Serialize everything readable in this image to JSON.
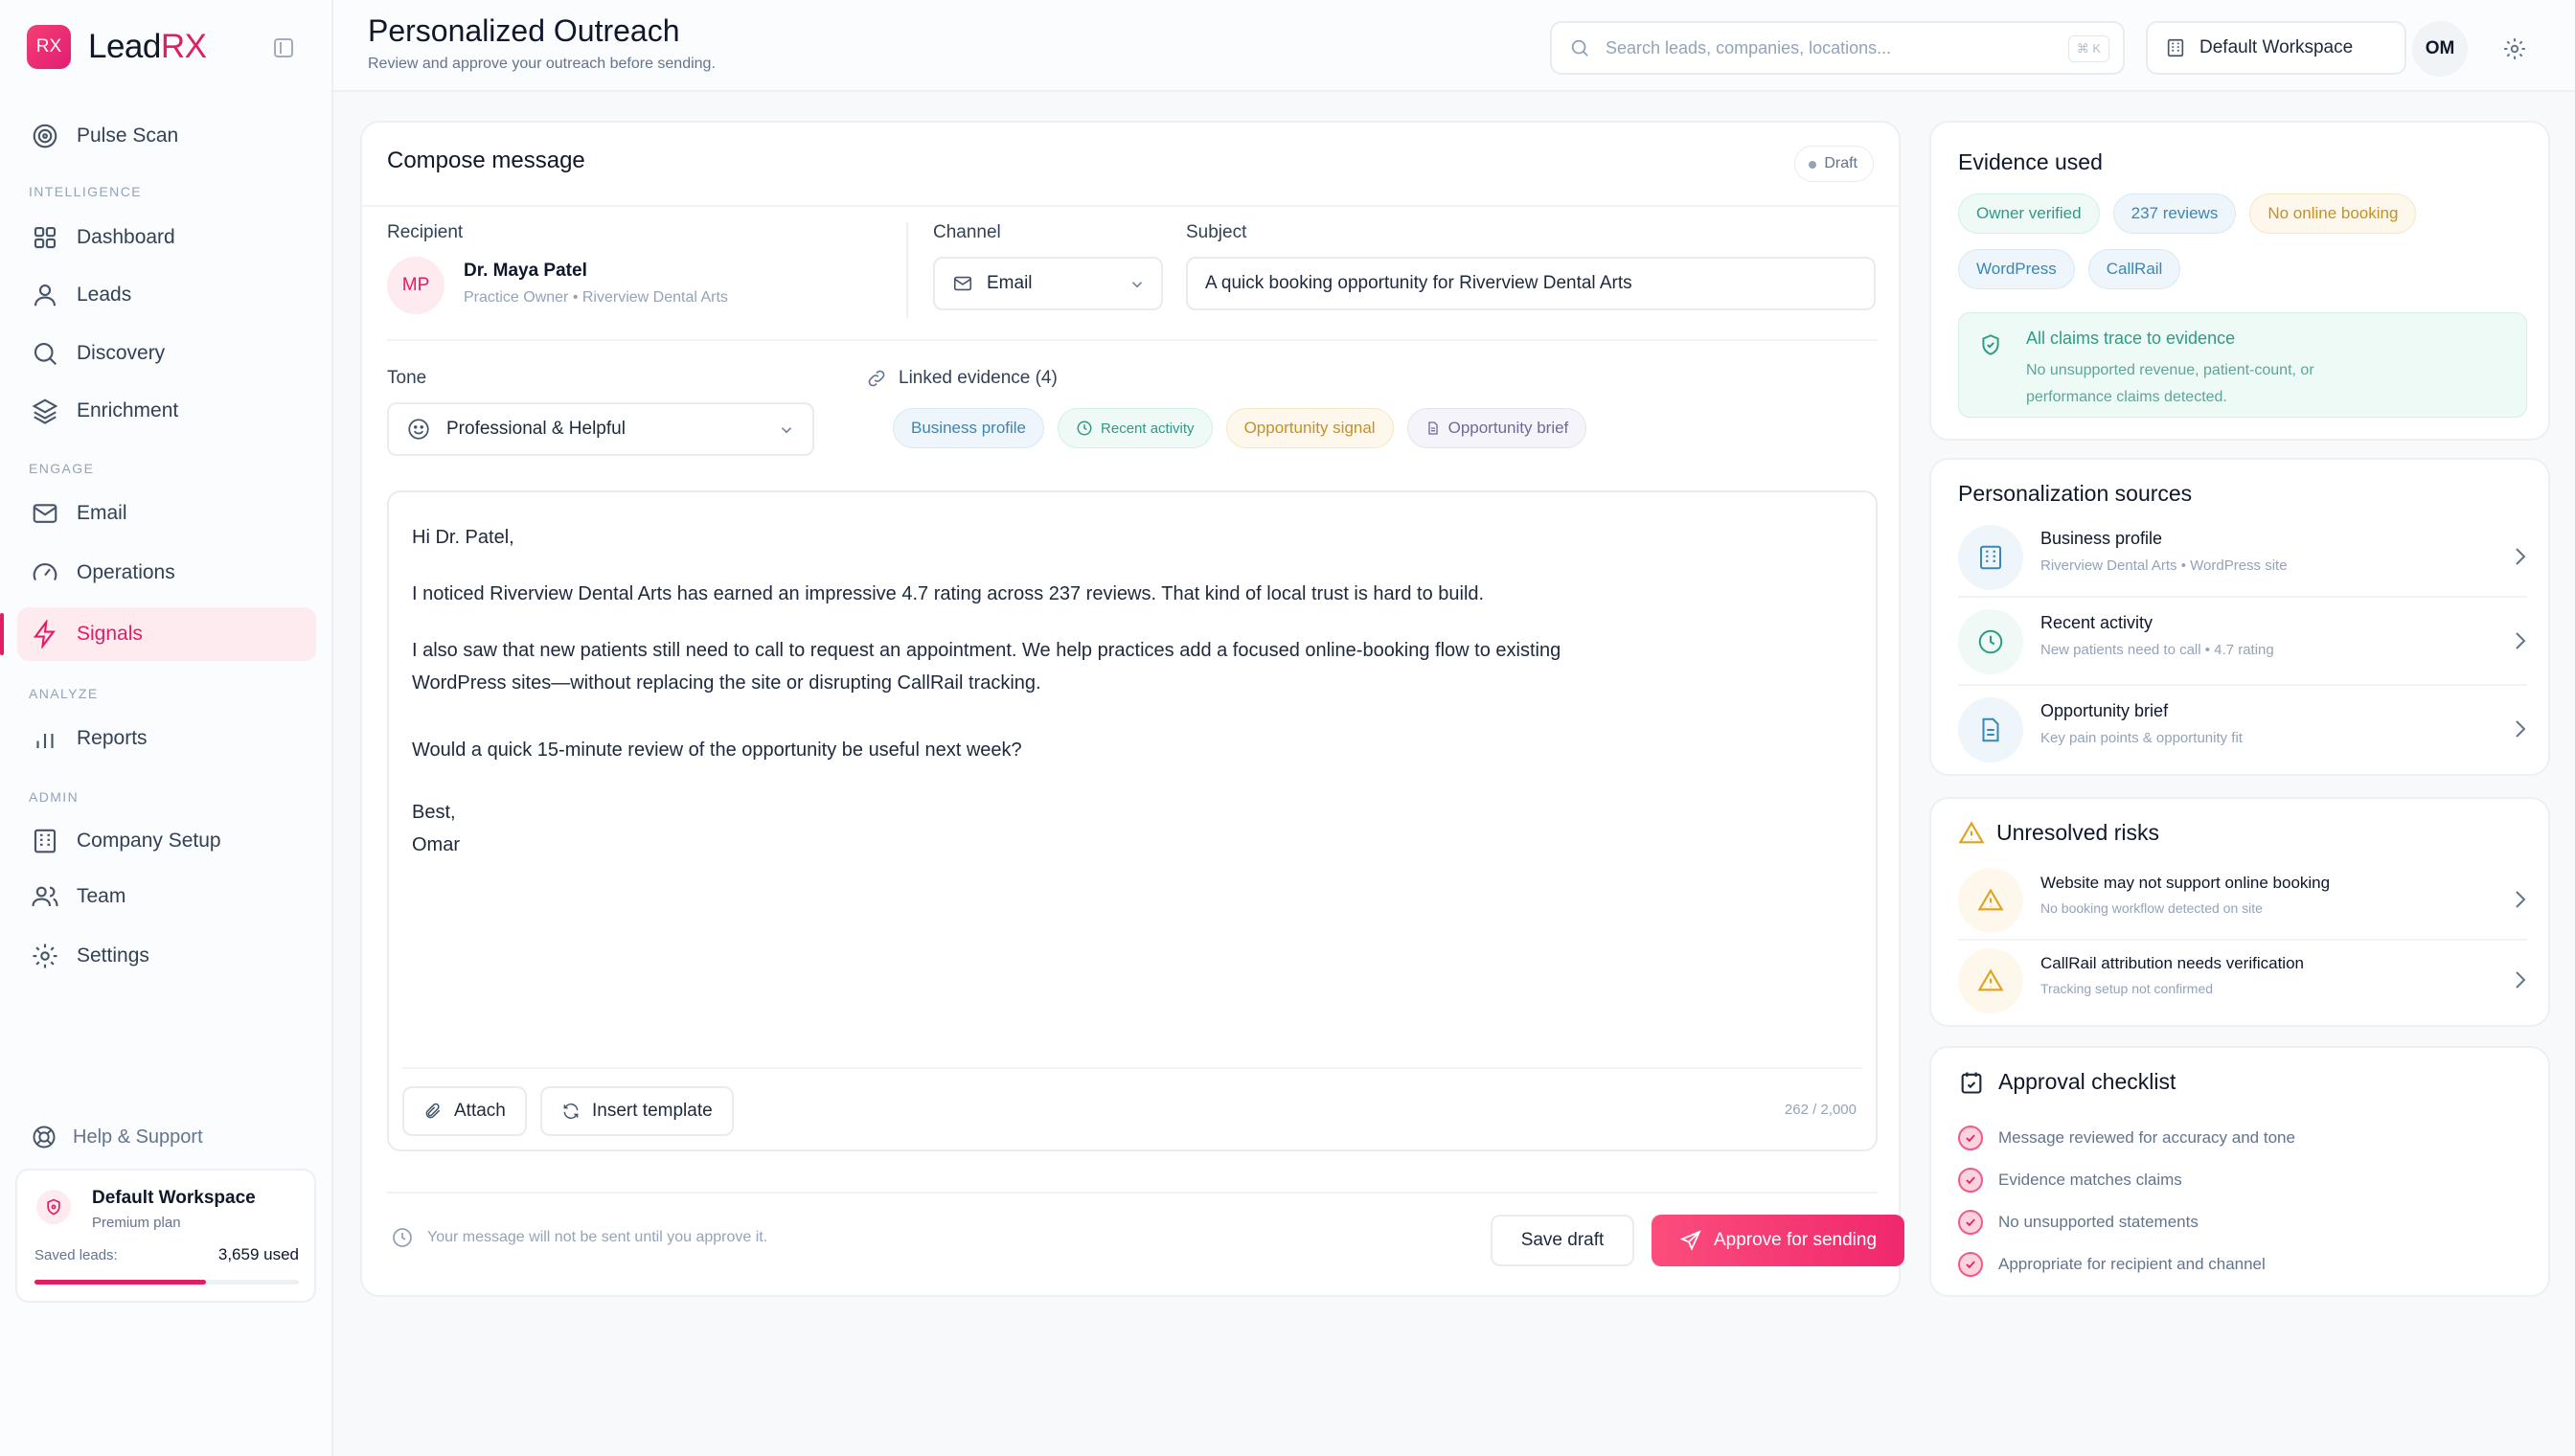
{
  "brand": {
    "logo": "RX",
    "name_a": "Lead",
    "name_b": "RX"
  },
  "sidebar": {
    "top_item": "Pulse Scan",
    "sections": [
      "INTELLIGENCE",
      "ENGAGE",
      "ANALYZE",
      "ADMIN"
    ],
    "items": [
      "Dashboard",
      "Leads",
      "Discovery",
      "Enrichment",
      "Email",
      "Operations",
      "Signals",
      "Reports",
      "Company Setup",
      "Team",
      "Settings"
    ],
    "active": "Signals",
    "help": "Help & Support",
    "workspace": {
      "name": "Default Workspace",
      "plan": "Premium plan",
      "saved_label": "Saved leads:",
      "saved_value": "3,659 used",
      "usage": 0.65
    }
  },
  "header": {
    "title": "Personalized Outreach",
    "subtitle": "Review and approve your outreach before sending.",
    "search_placeholder": "Search leads, companies, locations...",
    "search_shortcut": "⌘ K",
    "workspace_btn": "Default Workspace",
    "avatar": "OM"
  },
  "compose": {
    "title": "Compose message",
    "status": "Draft",
    "recipient_label": "Recipient",
    "recipient_initials": "MP",
    "recipient_name": "Dr. Maya Patel",
    "recipient_role": "Practice Owner • Riverview Dental Arts",
    "channel_label": "Channel",
    "channel_value": "Email",
    "subject_label": "Subject",
    "subject_value": "A quick booking opportunity for Riverview Dental Arts",
    "tone_label": "Tone",
    "tone_value": "Professional & Helpful",
    "evidence_label": "Linked evidence (4)",
    "evidence_chips": [
      "Business profile",
      "Recent activity",
      "Opportunity signal",
      "Opportunity brief"
    ],
    "body": {
      "greeting": "Hi Dr. Patel,",
      "p1": "I noticed Riverview Dental Arts has earned an impressive 4.7 rating across 237 reviews. That kind of local trust is hard to build.",
      "p2a": "I also saw that new patients still need to call to request an appointment. We help practices add a focused online-booking flow to existing",
      "p2b": "WordPress sites—without replacing the site or disrupting CallRail tracking.",
      "p3": "Would a quick 15-minute review of the opportunity be useful next week?",
      "signoff": "Best,",
      "name": "Omar"
    },
    "attach": "Attach",
    "insert_template": "Insert template",
    "counter": "262 / 2,000",
    "footer_note": "Your message will not be sent until you approve it.",
    "save_draft": "Save draft",
    "approve": "Approve for sending"
  },
  "evidence": {
    "title": "Evidence used",
    "chips": [
      "Owner verified",
      "237 reviews",
      "No online booking",
      "WordPress",
      "CallRail"
    ],
    "banner_title": "All claims trace to evidence",
    "banner_text_a": "No unsupported revenue, patient-count, or",
    "banner_text_b": "performance claims detected."
  },
  "sources": {
    "title": "Personalization sources",
    "items": [
      {
        "title": "Business profile",
        "sub": "Riverview Dental Arts • WordPress site"
      },
      {
        "title": "Recent activity",
        "sub": "New patients need to call • 4.7 rating"
      },
      {
        "title": "Opportunity brief",
        "sub": "Key pain points & opportunity fit"
      }
    ]
  },
  "risks": {
    "title": "Unresolved risks",
    "items": [
      {
        "title": "Website may not support online booking",
        "sub": "No booking workflow detected on site"
      },
      {
        "title": "CallRail attribution needs verification",
        "sub": "Tracking setup not confirmed"
      }
    ]
  },
  "checklist": {
    "title": "Approval checklist",
    "items": [
      "Message reviewed for accuracy and tone",
      "Evidence matches claims",
      "No unsupported statements",
      "Appropriate for recipient and channel"
    ]
  },
  "colors": {
    "accent": "#e11d63",
    "teal": "#2f9a86",
    "amber": "#e0a21b",
    "blue": "#3a86b4"
  }
}
